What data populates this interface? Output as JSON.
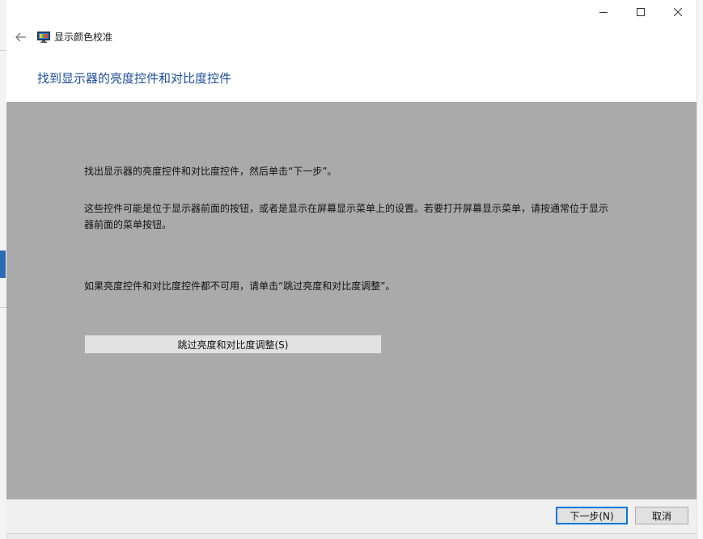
{
  "window": {
    "title": "显示颜色校准",
    "controls": {
      "minimize_icon": "minimize-icon",
      "maximize_icon": "maximize-icon",
      "close_icon": "close-icon"
    }
  },
  "nav": {
    "back_icon": "back-arrow-icon",
    "app_icon": "monitor-icon"
  },
  "page": {
    "heading": "找到显示器的亮度控件和对比度控件",
    "paragraph1": "找出显示器的亮度控件和对比度控件，然后单击“下一步”。",
    "paragraph2": "这些控件可能是位于显示器前面的按钮，或者是显示在屏幕显示菜单上的设置。若要打开屏幕显示菜单，请按通常位于显示器前面的菜单按钮。",
    "paragraph3": "如果亮度控件和对比度控件都不可用，请单击“跳过亮度和对比度调整”。",
    "skip_button": "跳过亮度和对比度调整(S)"
  },
  "footer": {
    "next_button": "下一步(N)",
    "cancel_button": "取消"
  },
  "colors": {
    "heading": "#1f4e99",
    "content_bg": "#aaaaaa",
    "accent": "#0078d7"
  }
}
